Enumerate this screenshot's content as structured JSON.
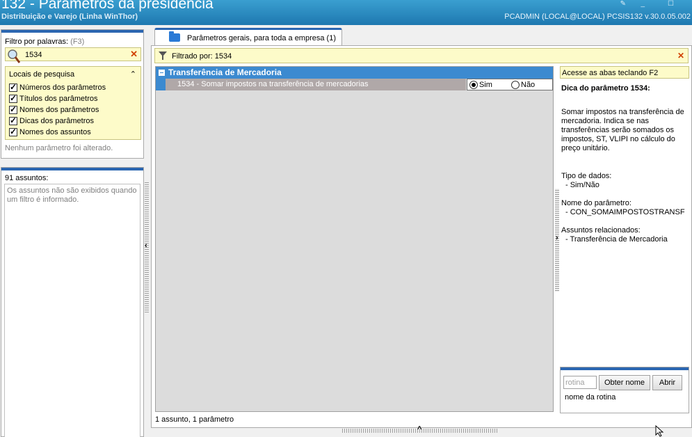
{
  "window": {
    "title": "132 - Parâmetros da presidência",
    "subtitle": "Distribuição e Varejo (Linha WinThor)",
    "user_info": "PCADMIN (LOCAL@LOCAL)   PCSIS132  v.30.0.05.002"
  },
  "filter": {
    "label": "Filtro por palavras:",
    "shortcut_hint": "(F3)",
    "value": "1534",
    "locais_title": "Locais de pesquisa",
    "options": [
      {
        "label": "Números dos parâmetros",
        "checked": true
      },
      {
        "label": "Títulos dos parâmetros",
        "checked": true
      },
      {
        "label": "Nomes dos parâmetros",
        "checked": true
      },
      {
        "label": "Dicas dos parâmetros",
        "checked": true
      },
      {
        "label": "Nomes dos assuntos",
        "checked": true
      }
    ],
    "status": "Nenhum parâmetro foi alterado."
  },
  "assuntos": {
    "count_label": "91 assuntos:",
    "empty_message": "Os assuntos não são exibidos quando um filtro é informado."
  },
  "tab": {
    "label": "Parâmetros gerais, para toda a empresa  (1)"
  },
  "filtered_by": "Filtrado por: 1534",
  "grid": {
    "group": "Transferência de Mercadoria",
    "row": {
      "description": "1534 - Somar impostos na transferência de mercadorias",
      "option_yes": "Sim",
      "option_no": "Não",
      "selected": "Sim"
    }
  },
  "footer_count": "1 assunto, 1 parâmetro",
  "info": {
    "key_hint": "Acesse as abas teclando F2",
    "dica_title": "Dica do parâmetro 1534:",
    "dica_body": "Somar impostos na transferência de mercadoria. Indica se nas transferências serão somados os impostos, ST, VLIPI no cálculo do preço unitário.",
    "tipo_label": "Tipo de dados:",
    "tipo_value": "- Sim/Não",
    "nome_label": "Nome do parâmetro:",
    "nome_value": "- CON_SOMAIMPOSTOSTRANSF",
    "assuntos_label": "Assuntos relacionados:",
    "assuntos_value": "- Transferência de Mercadoria"
  },
  "rotina": {
    "placeholder": "rotina",
    "obter_nome": "Obter nome",
    "abrir": "Abrir",
    "label": "nome da rotina"
  },
  "colors": {
    "accent": "#2b66b1",
    "group_header": "#3c8ad0",
    "highlight_yellow": "#fdfbc9"
  }
}
